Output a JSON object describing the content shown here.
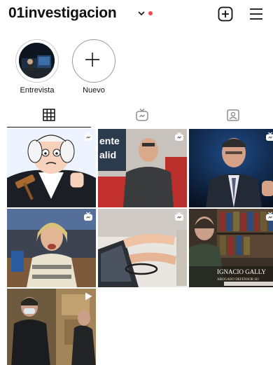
{
  "profile": {
    "username": "01investigacion",
    "notification_dot_color": "#ed4956"
  },
  "header_icons": {
    "new_post": "plus-square-icon",
    "menu": "hamburger-menu-icon"
  },
  "highlights": [
    {
      "label": "Entrevista",
      "icon": "video-thumbnail"
    },
    {
      "label": "Nuevo",
      "icon": "plus-icon"
    }
  ],
  "tabs": [
    {
      "name": "posts",
      "icon": "grid-icon",
      "active": true
    },
    {
      "name": "igtv",
      "icon": "tv-icon",
      "active": false
    },
    {
      "name": "tagged",
      "icon": "tagged-portrait-icon",
      "active": false
    }
  ],
  "posts": [
    {
      "type": "igtv",
      "badge": "igtv-icon",
      "scene": "cartoon-judge"
    },
    {
      "type": "igtv",
      "badge": "igtv-icon",
      "scene": "man-red-chair",
      "overlay_text": "ente / alid"
    },
    {
      "type": "igtv",
      "badge": "igtv-icon",
      "scene": "man-speaking-dark"
    },
    {
      "type": "igtv",
      "badge": "igtv-icon",
      "scene": "woman-parliament"
    },
    {
      "type": "igtv",
      "badge": "igtv-icon",
      "scene": "hands-laptop"
    },
    {
      "type": "igtv",
      "badge": "igtv-icon",
      "scene": "man-bookshelf",
      "overlay_text": "IGNACIO GALLY",
      "overlay_subtext": "ABOGADO DEFENSOR SO"
    },
    {
      "type": "video",
      "badge": "play-icon",
      "scene": "masked-man-walking"
    }
  ],
  "colors": {
    "text": "#111111",
    "accent_red": "#ed4956",
    "divider": "#dbdbdb",
    "inactive_icon": "#8e8e8e"
  }
}
